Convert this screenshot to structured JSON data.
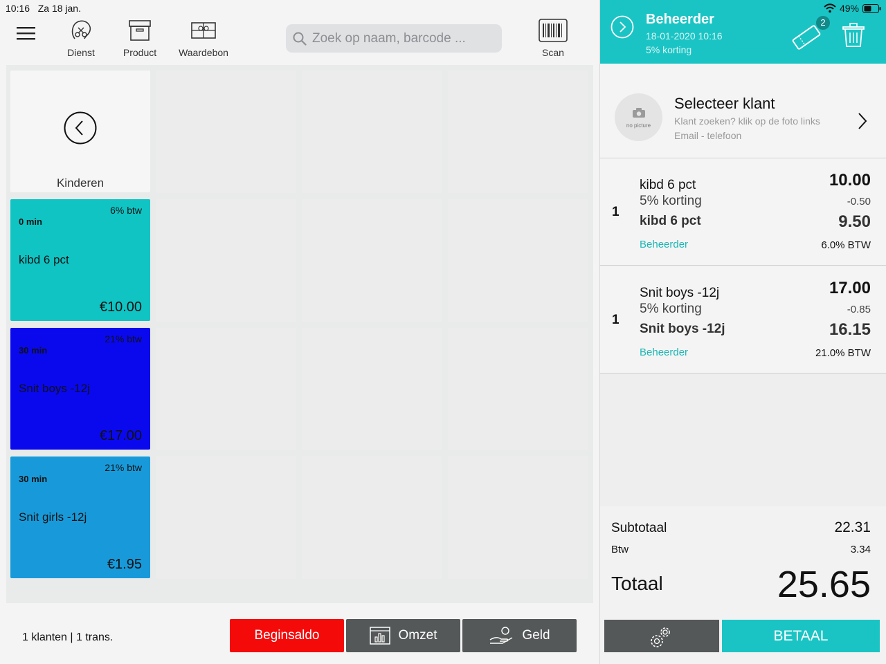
{
  "status": {
    "time": "10:16",
    "date": "Za 18 jan.",
    "battery": "49%"
  },
  "topbar": {
    "menu_icon": "hamburger-icon",
    "dienst_label": "Dienst",
    "product_label": "Product",
    "waardebon_label": "Waardebon",
    "scan_label": "Scan",
    "search_placeholder": "Zoek op naam, barcode ..."
  },
  "grid": {
    "back_tile_label": "Kinderen",
    "tiles": [
      {
        "btw": "6% btw",
        "duration": "0 min",
        "name": "kibd 6 pct",
        "price": "€10.00",
        "color": "#10c4c4"
      },
      {
        "btw": "21% btw",
        "duration": "30 min",
        "name": "Snit boys -12j",
        "price": "€17.00",
        "color": "#0a09ee"
      },
      {
        "btw": "21% btw",
        "duration": "30 min",
        "name": "Snit girls -12j",
        "price": "€1.95",
        "color": "#189ada"
      }
    ]
  },
  "bottombar": {
    "stats": "1 klanten | 1 trans.",
    "beginsaldo_label": "Beginsaldo",
    "omzet_label": "Omzet",
    "geld_label": "Geld",
    "beginsaldo_color": "#f50a0a",
    "dark_color": "#555858"
  },
  "cart_header": {
    "user": "Beheerder",
    "datetime": "18-01-2020 10:16",
    "discount": "5% korting",
    "voucher_badge": "2",
    "accent": "#1bc4c4"
  },
  "customer": {
    "title": "Selecteer klant",
    "hint": "Klant zoeken? klik op de foto links",
    "contact": "Email - telefoon",
    "avatar_text": "no picture"
  },
  "lines": [
    {
      "qty": "1",
      "name": "kibd 6 pct",
      "korting": "5% korting",
      "name2": "kibd 6 pct",
      "employee": "Beheerder",
      "price": "10.00",
      "discount": "-0.50",
      "net": "9.50",
      "btw": "6.0% BTW"
    },
    {
      "qty": "1",
      "name": "Snit boys -12j",
      "korting": "5% korting",
      "name2": "Snit boys -12j",
      "employee": "Beheerder",
      "price": "17.00",
      "discount": "-0.85",
      "net": "16.15",
      "btw": "21.0% BTW"
    }
  ],
  "totals": {
    "subtotaal_label": "Subtotaal",
    "subtotaal": "22.31",
    "btw_label": "Btw",
    "btw": "3.34",
    "totaal_label": "Totaal",
    "totaal": "25.65"
  },
  "actions": {
    "betaal_label": "BETAAL"
  }
}
